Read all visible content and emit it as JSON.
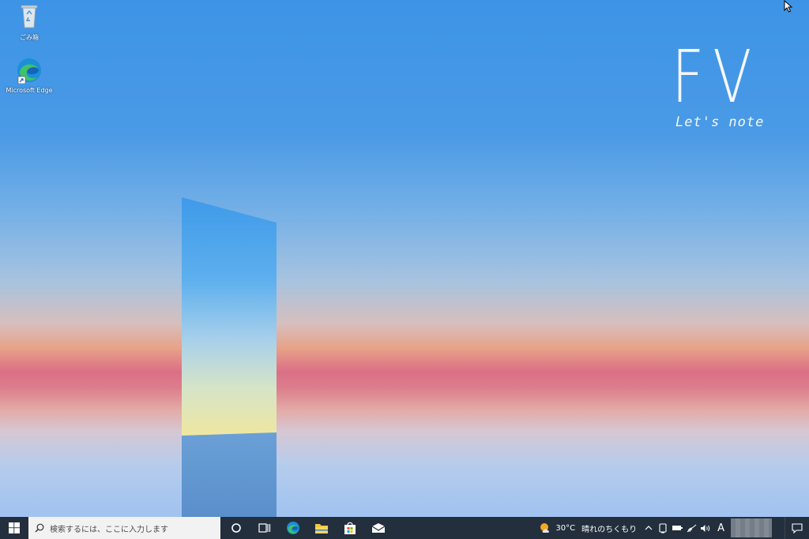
{
  "desktop": {
    "icons": [
      {
        "label": "ごみ箱",
        "icon": "recycle-bin-icon"
      },
      {
        "label": "Microsoft Edge",
        "icon": "edge-icon"
      }
    ],
    "wallpaper": {
      "brand_mark": "FV",
      "brand_sub": "Let's note"
    }
  },
  "taskbar": {
    "start_icon": "windows-logo-icon",
    "search_placeholder": "検索するには、ここに入力します",
    "pinned": [
      {
        "name": "cortana",
        "icon": "circle-icon"
      },
      {
        "name": "task-view",
        "icon": "task-view-icon"
      },
      {
        "name": "edge",
        "icon": "edge-icon"
      },
      {
        "name": "file-explorer",
        "icon": "folder-icon"
      },
      {
        "name": "microsoft-store",
        "icon": "store-bag-icon"
      },
      {
        "name": "mail",
        "icon": "mail-icon"
      }
    ],
    "tray": {
      "weather_temp": "30°C",
      "weather_desc": "晴れのちくもり",
      "ime": "A"
    }
  },
  "colors": {
    "taskbar_bg": "#232f3d",
    "search_bg": "#f2f2f2",
    "sky_top": "#3d94e6",
    "horizon_pink": "#db6f86"
  }
}
